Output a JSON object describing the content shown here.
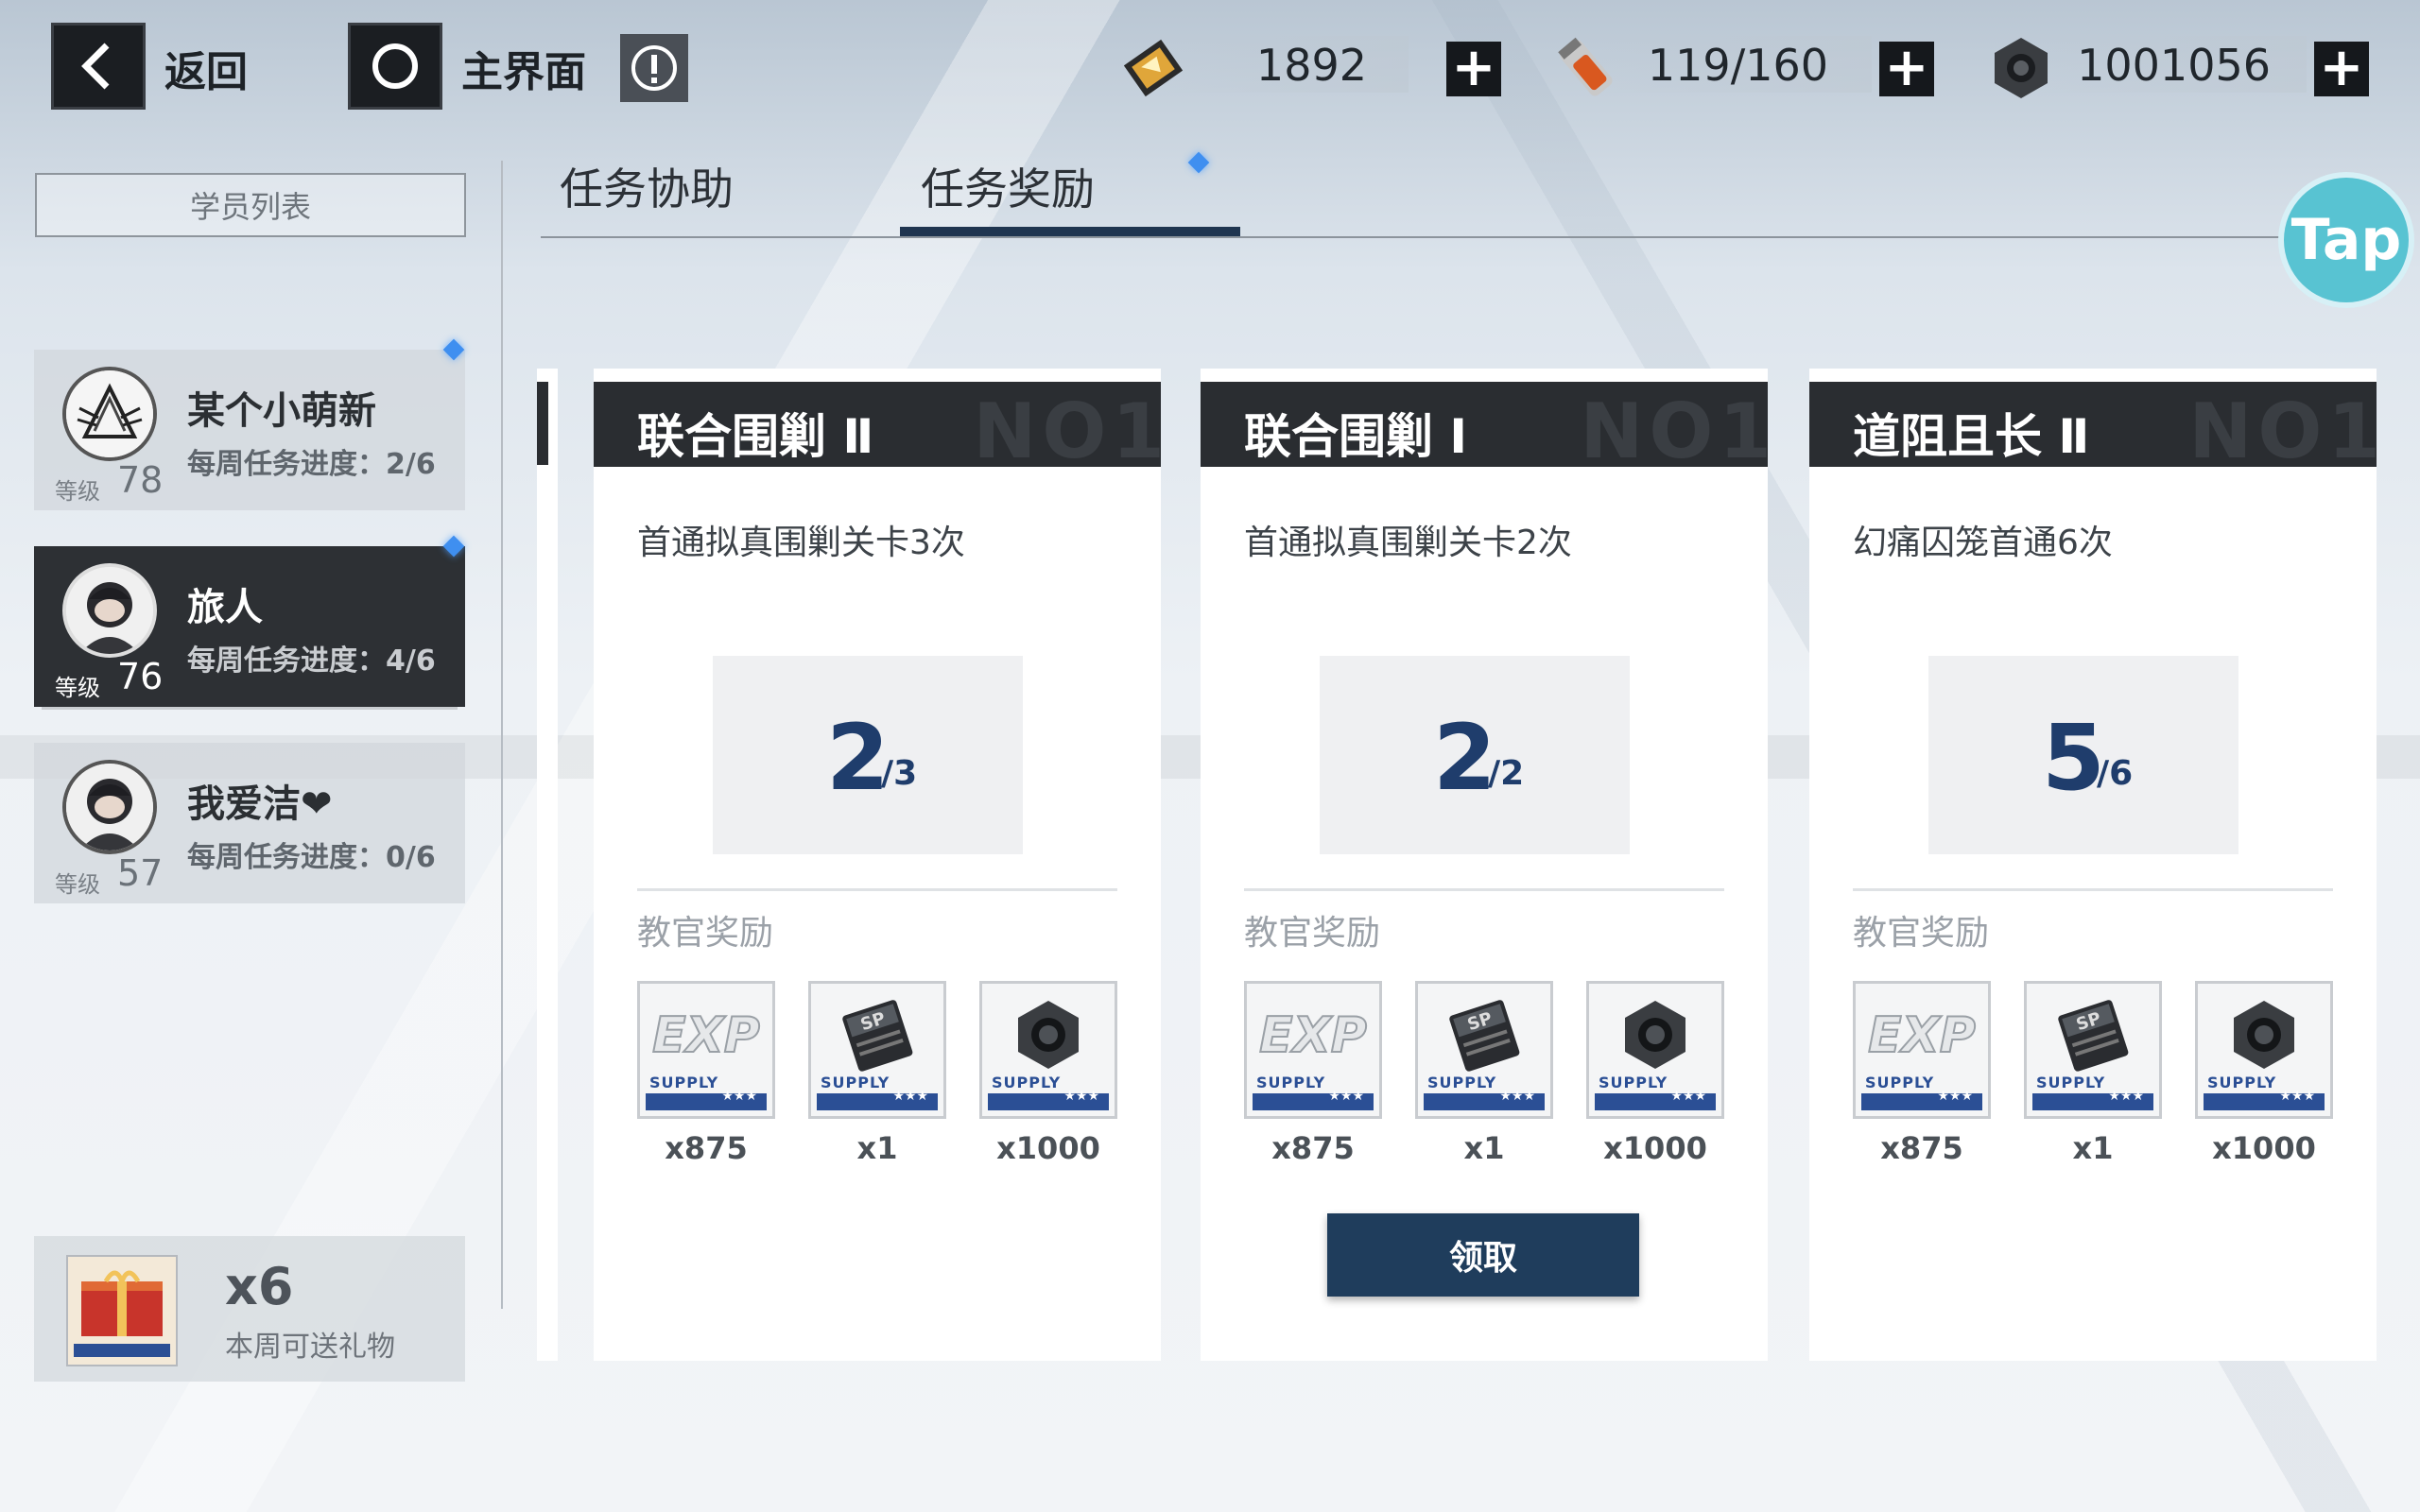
{
  "topbar": {
    "back_label": "返回",
    "home_label": "主界面",
    "resources": [
      {
        "icon": "gold-ticket-icon",
        "value": "1892"
      },
      {
        "icon": "stamina-vial-icon",
        "value": "119/160"
      },
      {
        "icon": "hex-nut-icon",
        "value": "1001056"
      }
    ]
  },
  "sidebar": {
    "list_button": "学员列表",
    "level_label": "等级",
    "students": [
      {
        "name": "某个小萌新",
        "progress": "每周任务进度：2/6",
        "level": "78",
        "selected": false
      },
      {
        "name": "旅人",
        "progress": "每周任务进度：4/6",
        "level": "76",
        "selected": true
      },
      {
        "name": "我爱洁❤",
        "progress": "每周任务进度：0/6",
        "level": "57",
        "selected": false
      }
    ],
    "gift": {
      "count": "x6",
      "label": "本周可送礼物"
    }
  },
  "tabs": [
    {
      "label": "任务协助",
      "active": false
    },
    {
      "label": "任务奖励",
      "active": true
    }
  ],
  "floating_button": "Tap",
  "missions": [
    {
      "title": "联合围剿 Ⅱ",
      "no_mark": "NO1",
      "desc": "首通拟真围剿关卡3次",
      "current": "2",
      "total": "/3",
      "reward_label": "教官奖励",
      "rewards": [
        {
          "icon": "exp-supply-icon",
          "qty": "x875"
        },
        {
          "icon": "sp-card-supply-icon",
          "qty": "x1"
        },
        {
          "icon": "hex-nut-supply-icon",
          "qty": "x1000"
        }
      ],
      "claim": null
    },
    {
      "title": "联合围剿 Ⅰ",
      "no_mark": "NO1",
      "desc": "首通拟真围剿关卡2次",
      "current": "2",
      "total": "/2",
      "reward_label": "教官奖励",
      "rewards": [
        {
          "icon": "exp-supply-icon",
          "qty": "x875"
        },
        {
          "icon": "sp-card-supply-icon",
          "qty": "x1"
        },
        {
          "icon": "hex-nut-supply-icon",
          "qty": "x1000"
        }
      ],
      "claim": "领取"
    },
    {
      "title": "道阻且长 Ⅱ",
      "no_mark": "NO1",
      "desc": "幻痛囚笼首通6次",
      "current": "5",
      "total": "/6",
      "reward_label": "教官奖励",
      "rewards": [
        {
          "icon": "exp-supply-icon",
          "qty": "x875"
        },
        {
          "icon": "sp-card-supply-icon",
          "qty": "x1"
        },
        {
          "icon": "hex-nut-supply-icon",
          "qty": "x1000"
        }
      ],
      "claim": null
    }
  ],
  "item_supply_text": "SUPPLY",
  "item_stars": "★★★",
  "colors": {
    "accent_dark": "#1f3d5c",
    "progress_blue": "#1f3d6c",
    "notice_diamond": "#3f8ff0",
    "tap_teal": "#58c3d2"
  }
}
